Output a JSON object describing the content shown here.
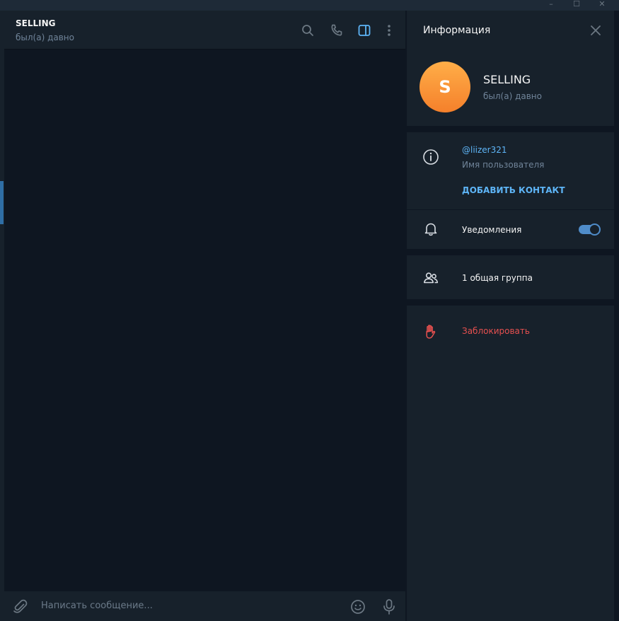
{
  "window": {
    "controls": {
      "minimize": "–",
      "maximize": "☐",
      "close": "✕"
    }
  },
  "chat": {
    "title": "SELLING",
    "status": "был(а) давно",
    "header_icons": [
      "search-icon",
      "phone-icon",
      "sidebar-toggle-icon",
      "more-icon"
    ],
    "composer": {
      "placeholder": "Написать сообщение...",
      "icons": [
        "attach-icon",
        "emoji-icon",
        "microphone-icon"
      ]
    }
  },
  "info_panel": {
    "title": "Информация",
    "avatar_letter": "S",
    "profile": {
      "name": "SELLING",
      "status": "был(а) давно"
    },
    "username": "@liizer321",
    "username_label": "Имя пользователя",
    "add_contact": "ДОБАВИТЬ КОНТАКТ",
    "notifications": {
      "label": "Уведомления",
      "enabled": true
    },
    "groups": "1 общая группа",
    "block": "Заблокировать"
  },
  "colors": {
    "bg_panel": "#17212b",
    "bg_chat": "#0e1621",
    "accent": "#5eb5f7",
    "toggle": "#4f8cc9",
    "danger": "#e6504f",
    "muted": "#708499",
    "avatar_top": "#ffae48",
    "avatar_bottom": "#f5802b"
  }
}
